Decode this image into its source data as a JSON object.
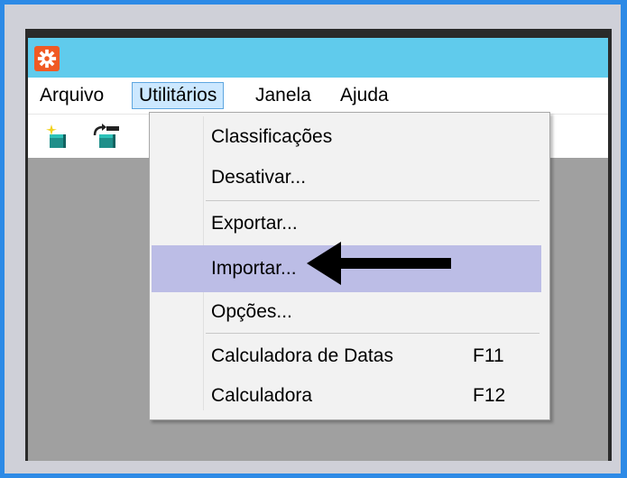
{
  "window": {
    "icon": "gear-icon"
  },
  "menubar": {
    "items": [
      {
        "label": "Arquivo"
      },
      {
        "label": "Utilitários",
        "active": true
      },
      {
        "label": "Janela"
      },
      {
        "label": "Ajuda"
      }
    ]
  },
  "toolbar": {
    "buttons": [
      {
        "icon": "new-record-icon"
      },
      {
        "icon": "refresh-record-icon"
      }
    ]
  },
  "dropdown": {
    "items": [
      {
        "label": "Classificações",
        "shortcut": ""
      },
      {
        "label": "Desativar...",
        "shortcut": ""
      },
      {
        "label": "Exportar...",
        "shortcut": ""
      },
      {
        "label": "Importar...",
        "shortcut": "",
        "highlighted": true
      },
      {
        "label": "Opções...",
        "shortcut": ""
      },
      {
        "label": "Calculadora de Datas",
        "shortcut": "F11"
      },
      {
        "label": "Calculadora",
        "shortcut": "F12"
      }
    ]
  },
  "annotation": {
    "icon": "left-arrow-icon",
    "color": "#000000"
  },
  "colors": {
    "title_bar": "#60cbec",
    "menu_active": "#cce8ff",
    "item_highlight": "#bcbde6",
    "workspace": "#a0a0a0",
    "app_icon": "#f05a24"
  }
}
